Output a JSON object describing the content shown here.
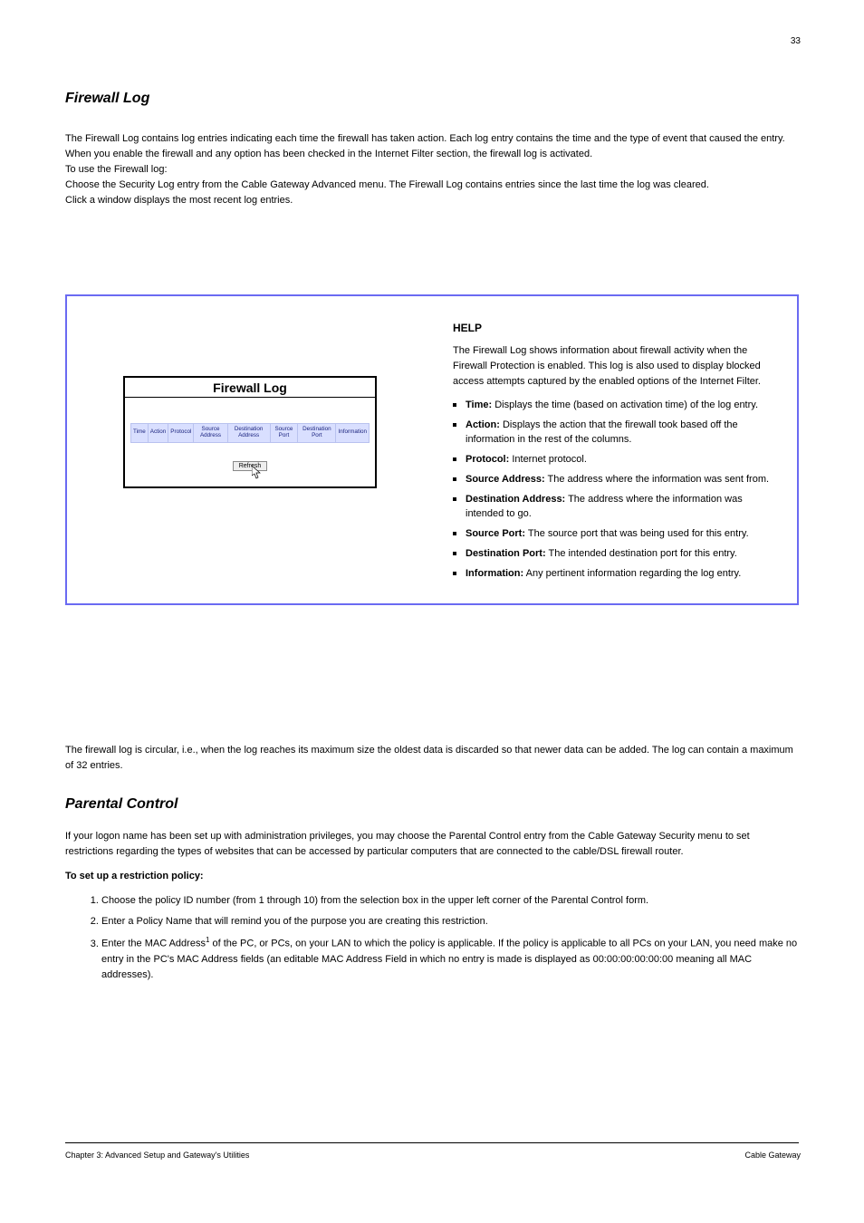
{
  "page_num_top": "33",
  "title": "Firewall Log",
  "intro": [
    "The Firewall Log contains log entries indicating each time the firewall has taken action. Each log entry contains the time and the type of event that caused the entry. When you enable the firewall and any option has been checked in the Internet Filter section, the firewall log is activated.",
    "To use the Firewall log:",
    "Choose the Security Log entry from the Cable Gateway Advanced menu. The Firewall Log contains entries since the last time the log was cleared.",
    "Click a window displays the most recent log entries."
  ],
  "panel": {
    "title": "Firewall Log",
    "headers": [
      "Time",
      "Action",
      "Protocol",
      "Source Address",
      "Destination Address",
      "Source Port",
      "Destination Port",
      "Information"
    ],
    "refresh_label": "Refresh"
  },
  "help": {
    "heading": "HELP",
    "para": "The Firewall Log shows information about firewall activity when the Firewall Protection is enabled. This log is also used to display blocked access attempts captured by the enabled options of the Internet Filter.",
    "items": [
      {
        "b": "Time:",
        "t": " Displays the time (based on activation time) of the log entry."
      },
      {
        "b": "Action:",
        "t": " Displays the action that the firewall took based off the information in the rest of the columns."
      },
      {
        "b": "Protocol:",
        "t": " Internet protocol."
      },
      {
        "b": "Source Address:",
        "t": " The address where the information was sent from."
      },
      {
        "b": "Destination Address:",
        "t": " The address where the information was intended to go."
      },
      {
        "b": "Source Port:",
        "t": " The source port that was being used for this entry."
      },
      {
        "b": "Destination Port:",
        "t": " The intended destination port for this entry."
      },
      {
        "b": "Information:",
        "t": " Any pertinent information regarding the log entry."
      }
    ]
  },
  "below": {
    "log_intro": "The firewall log is circular, i.e., when the log reaches its maximum size the oldest data is discarded so that newer data can be added. The log can contain a maximum of 32 entries.",
    "heading": "Parental Control",
    "paras": [
      "If your logon name has been set up with administration privileges, you may choose the Parental Control entry from the Cable Gateway Security menu to set restrictions regarding the types of websites that can be accessed by particular computers that are connected to the cable/DSL firewall router.",
      "To set up a restriction policy:"
    ],
    "ol": [
      "Choose the policy ID number (from 1 through 10) from the selection box in the upper left corner of the Parental Control form.",
      "Enter a Policy Name that will remind you of the purpose you are creating this restriction.",
      "Enter the MAC Address<sup>1</sup> of the PC, or PCs, on your LAN to which the policy is applicable. If the policy is applicable to all PCs on your LAN, you need make no entry in the PC's MAC Address fields (an editable MAC Address Field in which no entry is made is displayed as 00:00:00:00:00:00 meaning all MAC addresses)."
    ]
  },
  "footer": {
    "left": "Chapter 3: Advanced Setup and Gateway's Utilities",
    "right": "Cable Gateway"
  }
}
